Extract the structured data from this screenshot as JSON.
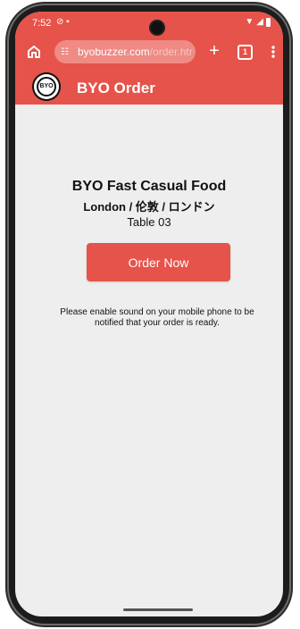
{
  "status_bar": {
    "time": "7:52",
    "left_icons": [
      "do-not-disturb-icon",
      "notification-card-icon"
    ],
    "right_icons": [
      "wifi-icon",
      "signal-icon",
      "battery-icon"
    ]
  },
  "browser": {
    "url_domain": "byobuzzer.com",
    "url_path": "/order.htr",
    "tabs_count": "1"
  },
  "app_header": {
    "logo_text": "BYO",
    "title": "BYO Order"
  },
  "page": {
    "restaurant_name": "BYO Fast Casual Food",
    "location": "London / 伦敦 / ロンドン",
    "table": "Table 03",
    "order_button": "Order Now",
    "notice": "Please enable sound on your mobile phone to be notified that your order is ready."
  },
  "colors": {
    "brand_red": "#e5534b",
    "page_background": "#eeeeee"
  }
}
